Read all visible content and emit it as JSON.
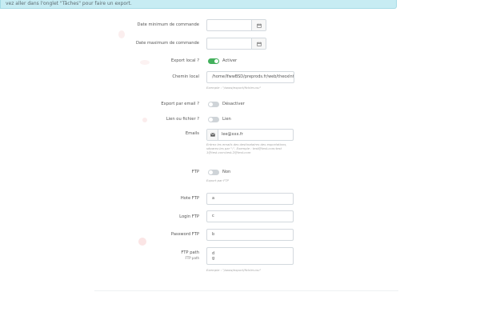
{
  "banner": {
    "text": "vez aller dans l'onglet \"Tâches\" pour faire un export."
  },
  "icons": {
    "calendar": "calendar-icon",
    "envelope": "envelope-icon"
  },
  "colors": {
    "switch_on": "#43b05c",
    "switch_off": "#cfd4d8",
    "banner_bg": "#c7ecf3"
  },
  "form": {
    "date_min": {
      "label": "Date minimum de commande",
      "value": ""
    },
    "date_max": {
      "label": "Date maximum de commande",
      "value": ""
    },
    "export_local": {
      "label": "Export local ?",
      "state": "on",
      "state_label": "Activer"
    },
    "chemin_local": {
      "label": "Chemin local",
      "value": "/home/lfwwBSD/preprods.fr/web/theoxlnt",
      "help": "Exemple : \"/www/export/fichier.csv\""
    },
    "export_email": {
      "label": "Export par email ?",
      "state": "off",
      "state_label": "Désactiver"
    },
    "lien_fichier": {
      "label": "Lien ou fichier ?",
      "state": "off",
      "state_label": "Lien"
    },
    "emails": {
      "label": "Emails",
      "value": "lee@xxx.fr",
      "help_lines": [
        "Entrez les emails des destinataires des exportations,",
        "séparez-les par \";\". Exemple : test@test.com;test",
        "1@test.com;test.2@test.com"
      ]
    },
    "ftp": {
      "label": "FTP",
      "state": "off",
      "state_label": "Non",
      "help": "Export par FTP"
    },
    "hote_ftp": {
      "label": "Hote FTP",
      "value": "a"
    },
    "login_ftp": {
      "label": "Login FTP",
      "value": "c"
    },
    "password_ftp": {
      "label": "Password FTP",
      "value": "b"
    },
    "ftp_path": {
      "label": "FTP path",
      "sublabel": "FTP path",
      "value_lines": [
        "d",
        "g"
      ],
      "help": "Exemple : \"/www/export/fichier.csv\""
    }
  }
}
